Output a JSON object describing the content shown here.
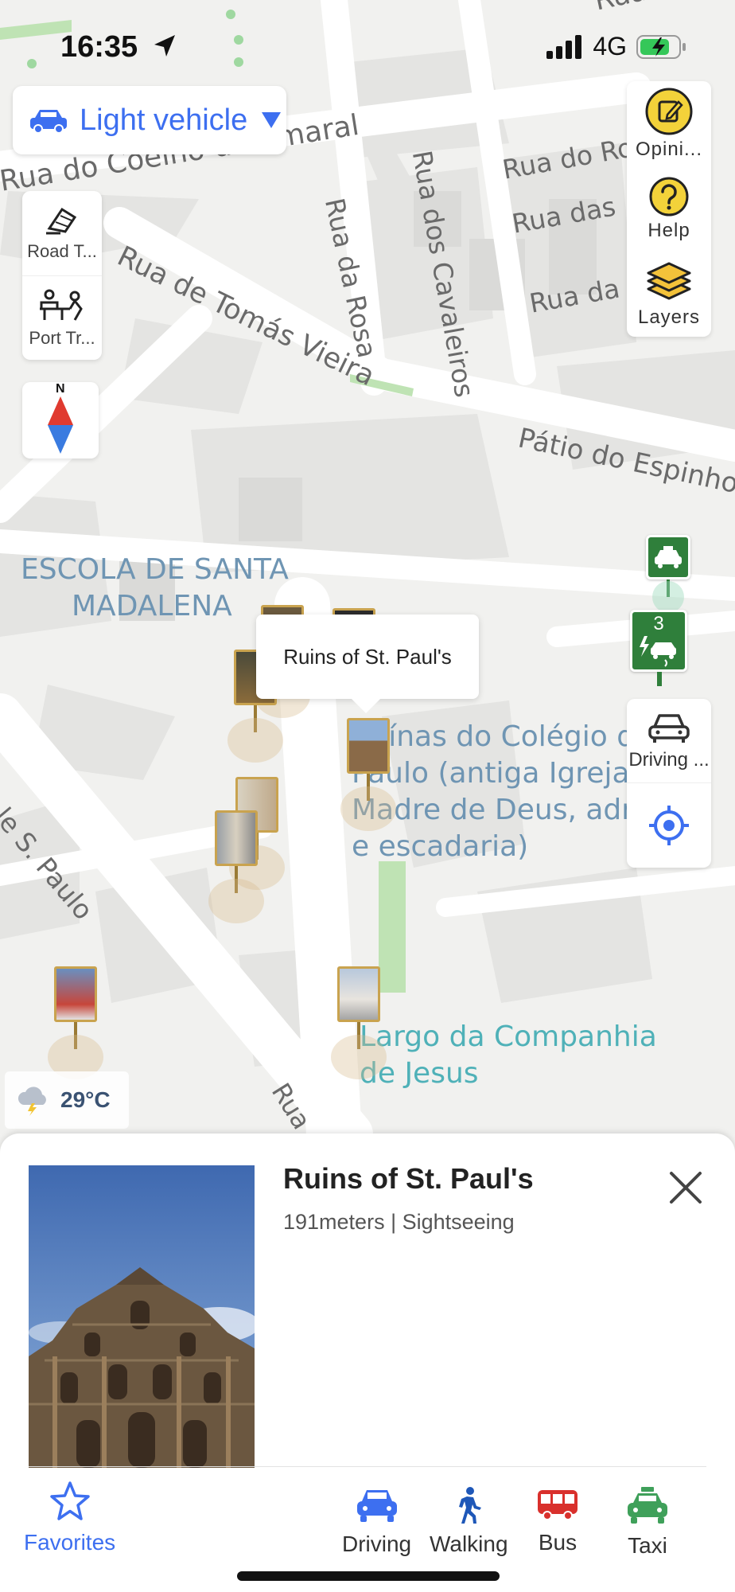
{
  "status_bar": {
    "time": "16:35",
    "network": "4G"
  },
  "vehicle_selector": {
    "label": "Light vehicle"
  },
  "left_tools": [
    {
      "label": "Road T..."
    },
    {
      "label": "Port Tr..."
    }
  ],
  "compass": {
    "north_label": "N"
  },
  "right_tools": [
    {
      "label": "Opini..."
    },
    {
      "label": "Help"
    },
    {
      "label": "Layers"
    }
  ],
  "map_labels": {
    "streets": {
      "coelho": "Rua do Coelho do Amaral",
      "tomas": "Rua de Tomás Vieira",
      "rosa": "Rua da Rosa",
      "cavaleiros": "Rua dos Cavaleiros",
      "rua_do_r": "Rua do Ro",
      "rua_das": "Rua das",
      "rua_da": "Rua da",
      "patio": "Pátio do Espinho",
      "s_paulo": "le S. Paulo",
      "rua_de": "Rua de",
      "top_rua": "Rua"
    },
    "pois": {
      "escola_line1": "ESCOLA DE SANTA",
      "escola_line2": "MADALENA",
      "ruinas_line1": "Ruínas do Colégio d",
      "ruinas_line2": "Paulo (antiga Igreja",
      "ruinas_line3": "Madre de Deus, adr",
      "ruinas_line4": "e escadaria)",
      "largo_line1": "Largo da Companhia",
      "largo_line2": "de Jesus"
    }
  },
  "callout": {
    "text": "Ruins of St. Paul's"
  },
  "charging_marker": {
    "count": "3"
  },
  "driving_panel": {
    "label": "Driving ..."
  },
  "weather": {
    "temperature": "29°C"
  },
  "place": {
    "title": "Ruins of St. Paul's",
    "subtitle": "191meters | Sightseeing"
  },
  "bottom_nav": {
    "favorites": "Favorites",
    "driving": "Driving",
    "walking": "Walking",
    "bus": "Bus",
    "taxi": "Taxi"
  },
  "colors": {
    "accent_blue": "#3d6ff0",
    "bus_red": "#d9302c",
    "taxi_green": "#3fa05a",
    "poi_teal": "#4fb1b8",
    "poi_blue": "#6f95b3"
  }
}
